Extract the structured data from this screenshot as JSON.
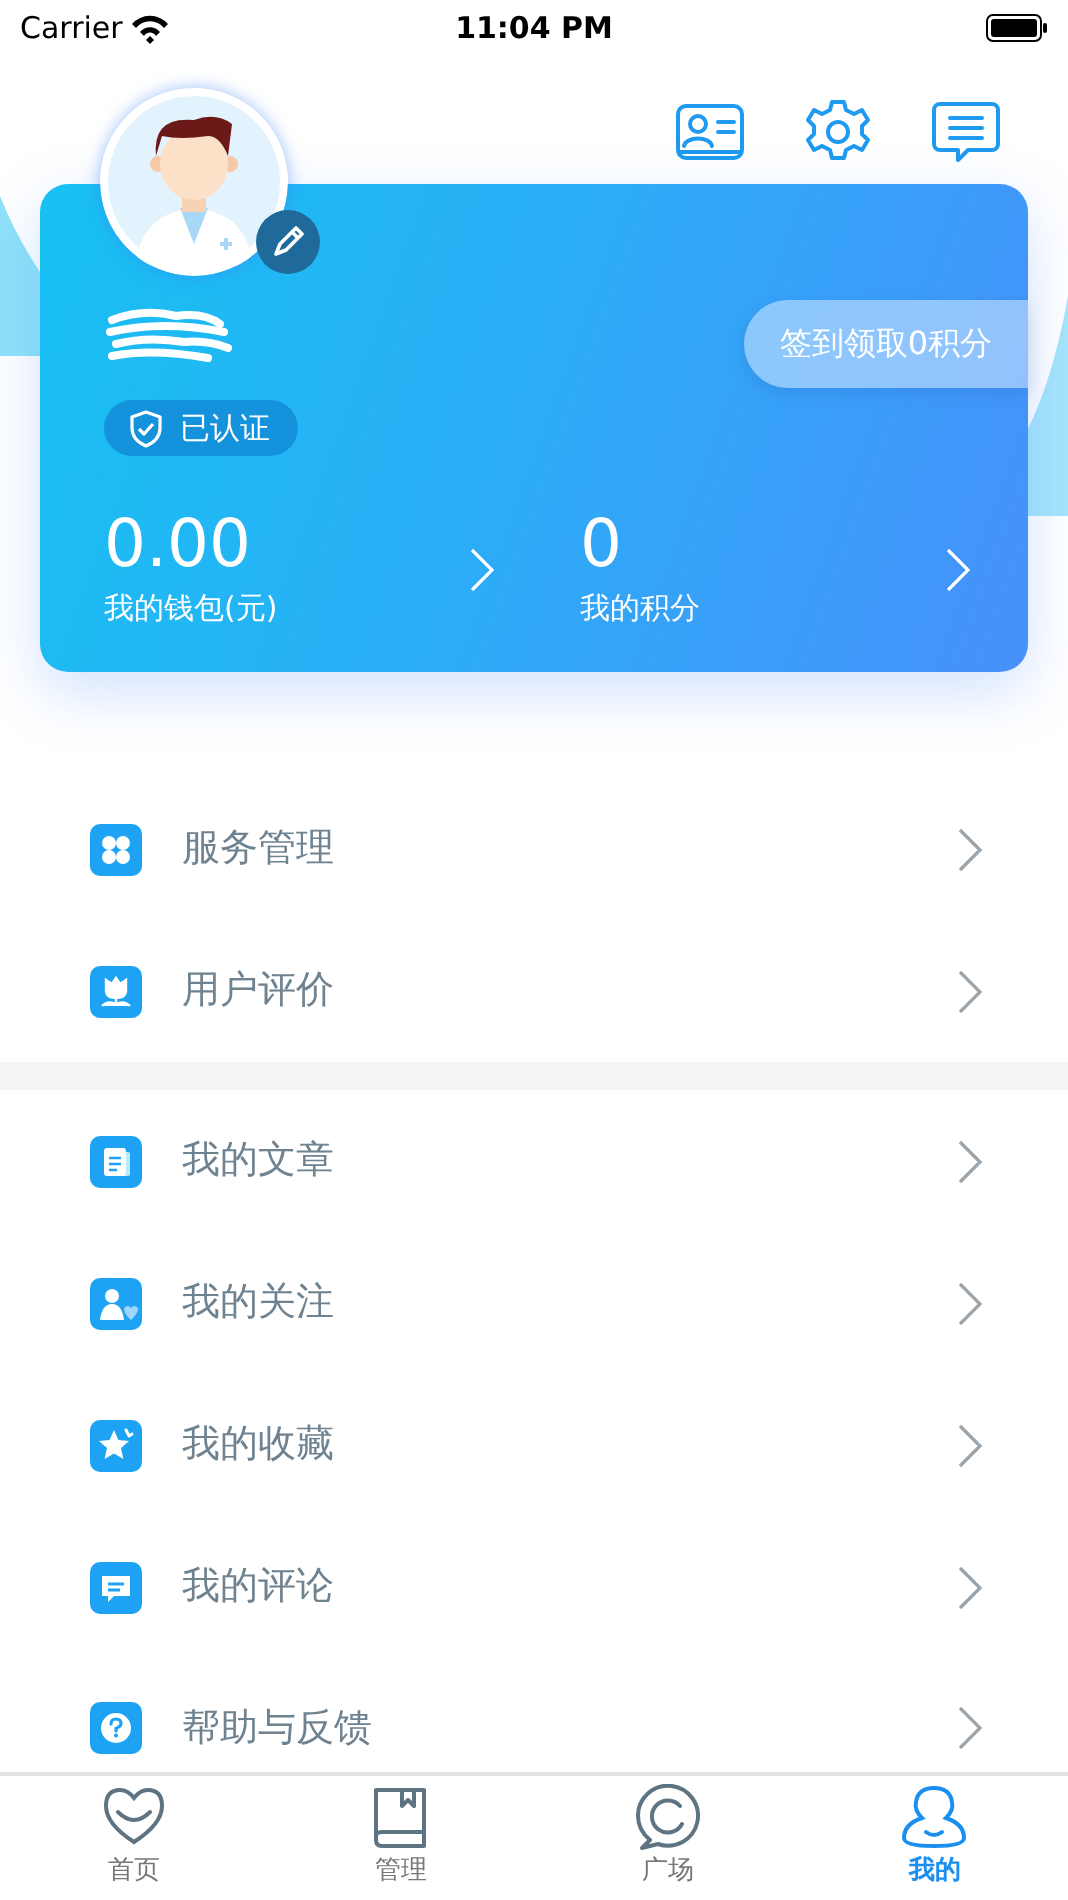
{
  "status_bar": {
    "carrier": "Carrier",
    "time": "11:04 PM"
  },
  "profile": {
    "verified": "已认证",
    "checkin": "签到领取0积分",
    "stats": [
      {
        "value": "0.00",
        "label": "我的钱包(元)"
      },
      {
        "value": "0",
        "label": "我的积分"
      }
    ]
  },
  "menu_groups": [
    [
      {
        "label": "服务管理"
      },
      {
        "label": "用户评价"
      }
    ],
    [
      {
        "label": "我的文章"
      },
      {
        "label": "我的关注"
      },
      {
        "label": "我的收藏"
      },
      {
        "label": "我的评论"
      },
      {
        "label": "帮助与反馈"
      }
    ]
  ],
  "tabs": [
    {
      "label": "首页",
      "selected": false
    },
    {
      "label": "管理",
      "selected": false
    },
    {
      "label": "广场",
      "selected": false
    },
    {
      "label": "我的",
      "selected": true
    }
  ]
}
